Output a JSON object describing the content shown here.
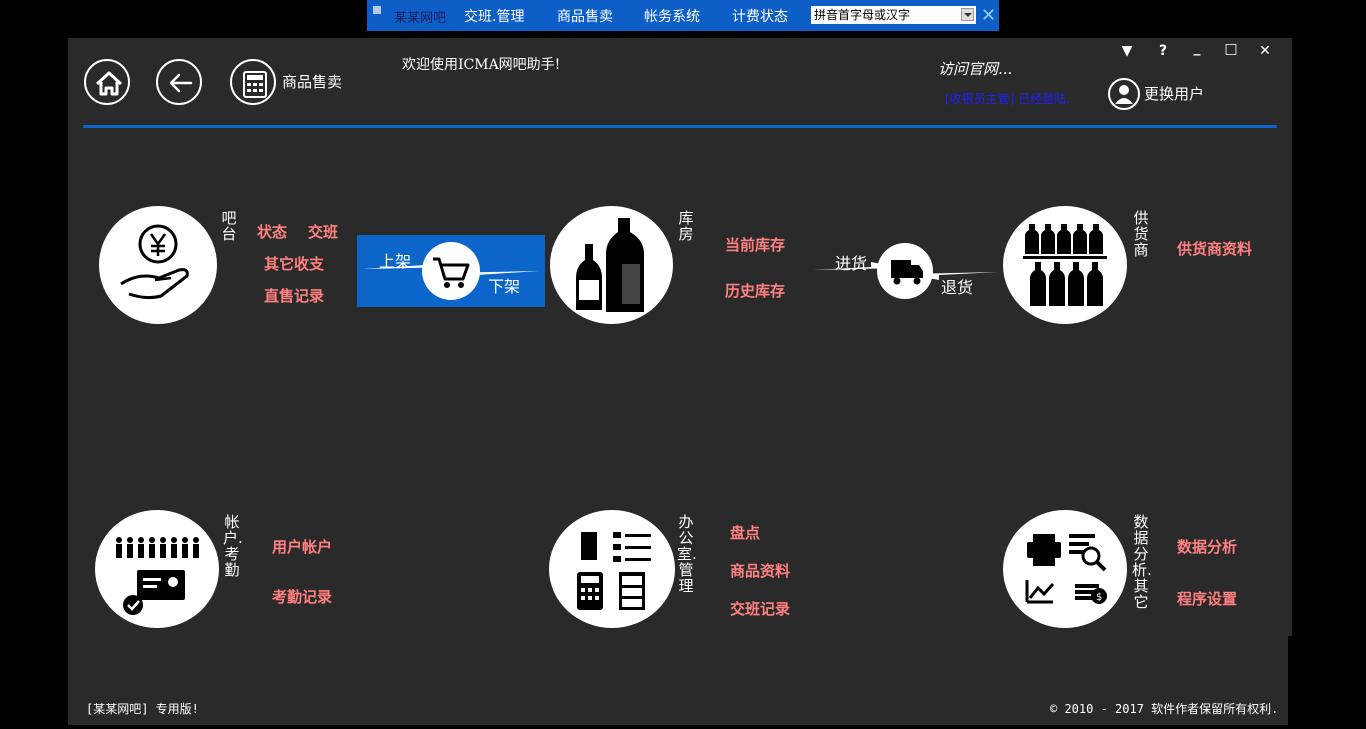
{
  "topbar": {
    "brand": "某某网吧",
    "items": [
      "交班.管理",
      "商品售卖",
      "帐务系统",
      "计费状态"
    ],
    "search_value": "拼音首字母或汉字",
    "close": "✕"
  },
  "header": {
    "current_module": "商品售卖",
    "welcome": "欢迎使用ICMA网吧助手!",
    "visit_site": "访问官网...",
    "status_link": "[收银员主管] 已经登陆.",
    "switch_user": "更换用户",
    "controls": {
      "menu": "▼",
      "help": "?",
      "minimize": "_",
      "maximize": "□",
      "close": "✕"
    }
  },
  "sections": {
    "bar": {
      "label": "吧台",
      "links": [
        "状态",
        "交班",
        "其它收支",
        "直售记录"
      ]
    },
    "shelf": {
      "up": "上架",
      "down": "下架"
    },
    "warehouse": {
      "label": "库房",
      "links": [
        "当前库存",
        "历史库存"
      ]
    },
    "purchase": {
      "in": "进货",
      "out": "退货"
    },
    "supplier": {
      "label": "供货商",
      "links": [
        "供货商资料"
      ]
    },
    "account": {
      "label": "帐户.考勤",
      "links": [
        "用户帐户",
        "考勤记录"
      ]
    },
    "office": {
      "label": "办公室.管理",
      "links": [
        "盘点",
        "商品资料",
        "交班记录"
      ]
    },
    "data": {
      "label": "数据分析.其它",
      "links": [
        "数据分析",
        "程序设置"
      ]
    }
  },
  "footer": {
    "edition": "[某某网吧] 专用版!",
    "copyright": "© 2010 - 2017 软件作者保留所有权利."
  },
  "colors": {
    "accent": "#0c66c9",
    "link": "#ff8080",
    "panel": "#2a2a2a",
    "topbar": "#0d5fc7"
  }
}
